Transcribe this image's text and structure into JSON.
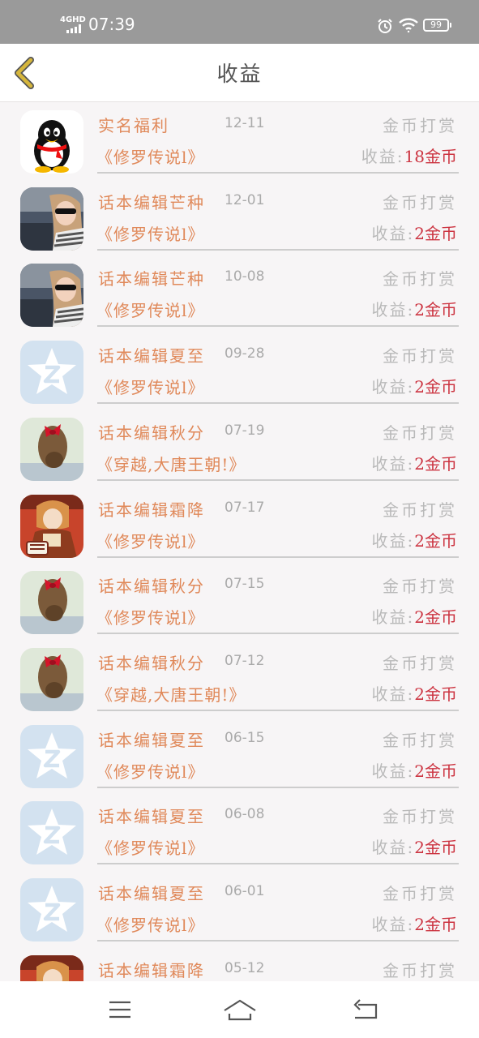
{
  "status": {
    "network": "4GHD",
    "time": "07:39",
    "battery": "99"
  },
  "header": {
    "title": "收益"
  },
  "icons": {
    "back": "chevron-left-icon",
    "menu": "menu-icon",
    "home": "home-icon",
    "return": "return-icon"
  },
  "colors": {
    "accent": "#e0895a",
    "earning": "#cc3340",
    "muted": "#b9b9b9",
    "back_icon": "#d6b63c"
  },
  "rows": [
    {
      "avatar": "qq-penguin",
      "name": "实名福利",
      "date": "12-11",
      "type": "金币打赏",
      "book": "《修罗传说l》",
      "label": "收益:",
      "value": "18金币"
    },
    {
      "avatar": "woman-sunglasses",
      "name": "话本编辑芒种",
      "date": "12-01",
      "type": "金币打赏",
      "book": "《修罗传说l》",
      "label": "收益:",
      "value": "2金币"
    },
    {
      "avatar": "woman-sunglasses",
      "name": "话本编辑芒种",
      "date": "10-08",
      "type": "金币打赏",
      "book": "《修罗传说l》",
      "label": "收益:",
      "value": "2金币"
    },
    {
      "avatar": "qzone-star",
      "name": "话本编辑夏至",
      "date": "09-28",
      "type": "金币打赏",
      "book": "《修罗传说l》",
      "label": "收益:",
      "value": "2金币"
    },
    {
      "avatar": "hair-bow",
      "name": "话本编辑秋分",
      "date": "07-19",
      "type": "金币打赏",
      "book": "《穿越,大唐王朝!》",
      "label": "收益:",
      "value": "2金币"
    },
    {
      "avatar": "anime-character",
      "name": "话本编辑霜降",
      "date": "07-17",
      "type": "金币打赏",
      "book": "《修罗传说l》",
      "label": "收益:",
      "value": "2金币"
    },
    {
      "avatar": "hair-bow",
      "name": "话本编辑秋分",
      "date": "07-15",
      "type": "金币打赏",
      "book": "《修罗传说l》",
      "label": "收益:",
      "value": "2金币"
    },
    {
      "avatar": "hair-bow",
      "name": "话本编辑秋分",
      "date": "07-12",
      "type": "金币打赏",
      "book": "《穿越,大唐王朝!》",
      "label": "收益:",
      "value": "2金币"
    },
    {
      "avatar": "qzone-star",
      "name": "话本编辑夏至",
      "date": "06-15",
      "type": "金币打赏",
      "book": "《修罗传说l》",
      "label": "收益:",
      "value": "2金币"
    },
    {
      "avatar": "qzone-star",
      "name": "话本编辑夏至",
      "date": "06-08",
      "type": "金币打赏",
      "book": "《修罗传说l》",
      "label": "收益:",
      "value": "2金币"
    },
    {
      "avatar": "qzone-star",
      "name": "话本编辑夏至",
      "date": "06-01",
      "type": "金币打赏",
      "book": "《修罗传说l》",
      "label": "收益:",
      "value": "2金币"
    },
    {
      "avatar": "anime-character",
      "name": "话本编辑霜降",
      "date": "05-12",
      "type": "金币打赏",
      "book": "",
      "label": "",
      "value": ""
    }
  ]
}
